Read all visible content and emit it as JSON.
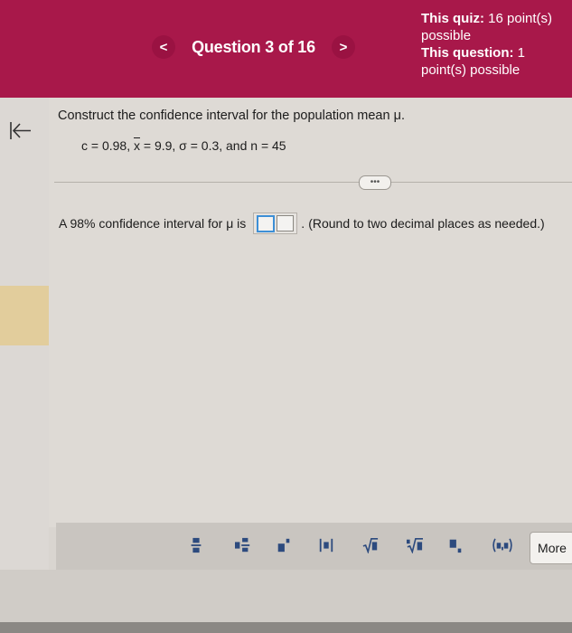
{
  "header": {
    "prev_label": "<",
    "next_label": ">",
    "question_position": "Question 3 of 16",
    "quiz_points_label": "This quiz:",
    "quiz_points_value": "16 point(s) possible",
    "question_points_label": "This question:",
    "question_points_value": "1 point(s) possible"
  },
  "problem": {
    "prompt": "Construct the confidence interval for the population mean μ.",
    "given_c": "c = 0.98, ",
    "given_xbar_symbol": "x",
    "given_rest": " = 9.9, σ = 0.3, and n = 45",
    "expand_label": "•••"
  },
  "answer": {
    "lead_text": "A 98% confidence interval for μ is",
    "after_box": ".",
    "round_note": "(Round to two decimal places as needed.)"
  },
  "toolbar": {
    "more_label": "More",
    "tools": [
      "fraction-icon",
      "mixed-number-icon",
      "exponent-icon",
      "absolute-value-icon",
      "square-root-icon",
      "nth-root-icon",
      "subscript-icon",
      "interval-icon"
    ]
  },
  "colors": {
    "header": "#a8184a",
    "accent": "#3d8fd6"
  }
}
